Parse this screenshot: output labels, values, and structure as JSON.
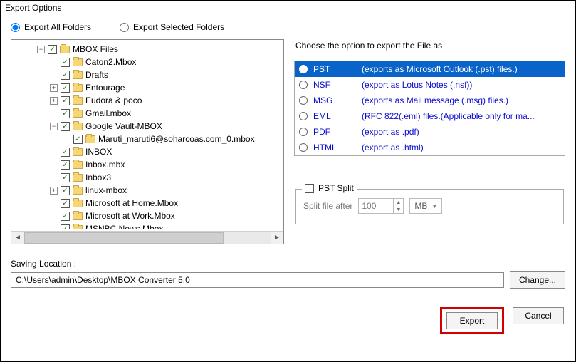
{
  "window": {
    "title": "Export Options"
  },
  "mode": {
    "all_label": "Export All Folders",
    "selected_label": "Export Selected Folders",
    "value": "all"
  },
  "tree": {
    "root_label": "MBOX Files",
    "items": [
      {
        "label": "Caton2.Mbox",
        "indent": 2,
        "expander": "",
        "checked": true
      },
      {
        "label": "Drafts",
        "indent": 2,
        "expander": "",
        "checked": true
      },
      {
        "label": "Entourage",
        "indent": 2,
        "expander": "+",
        "checked": true
      },
      {
        "label": "Eudora & poco",
        "indent": 2,
        "expander": "+",
        "checked": true
      },
      {
        "label": "Gmail.mbox",
        "indent": 2,
        "expander": "",
        "checked": true
      },
      {
        "label": "Google Vault-MBOX",
        "indent": 2,
        "expander": "−",
        "checked": true
      },
      {
        "label": "Maruti_maruti6@soharcoas.com_0.mbox",
        "indent": 3,
        "expander": "",
        "checked": true
      },
      {
        "label": "INBOX",
        "indent": 2,
        "expander": "",
        "checked": true
      },
      {
        "label": "Inbox.mbx",
        "indent": 2,
        "expander": "",
        "checked": true
      },
      {
        "label": "Inbox3",
        "indent": 2,
        "expander": "",
        "checked": true
      },
      {
        "label": "linux-mbox",
        "indent": 2,
        "expander": "+",
        "checked": true
      },
      {
        "label": "Microsoft at Home.Mbox",
        "indent": 2,
        "expander": "",
        "checked": true
      },
      {
        "label": "Microsoft at Work.Mbox",
        "indent": 2,
        "expander": "",
        "checked": true
      },
      {
        "label": "MSNBC News.Mbox",
        "indent": 2,
        "expander": "",
        "checked": true
      }
    ]
  },
  "formats": {
    "heading": "Choose the option to export the File as",
    "options": [
      {
        "name": "PST",
        "desc": "(exports as Microsoft Outlook (.pst) files.)",
        "selected": true
      },
      {
        "name": "NSF",
        "desc": "(export as Lotus Notes (.nsf))",
        "selected": false
      },
      {
        "name": "MSG",
        "desc": "(exports as Mail message (.msg) files.)",
        "selected": false
      },
      {
        "name": "EML",
        "desc": "(RFC 822(.eml) files.(Applicable only for ma...",
        "selected": false
      },
      {
        "name": "PDF",
        "desc": "(export as .pdf)",
        "selected": false
      },
      {
        "name": "HTML",
        "desc": "(export as .html)",
        "selected": false
      }
    ]
  },
  "split": {
    "legend": "PST Split",
    "label": "Split file after",
    "value": "100",
    "unit": "MB",
    "enabled": false
  },
  "save": {
    "label": "Saving Location :",
    "path": "C:\\Users\\admin\\Desktop\\MBOX Converter 5.0",
    "change_btn": "Change..."
  },
  "actions": {
    "export": "Export",
    "cancel": "Cancel"
  }
}
